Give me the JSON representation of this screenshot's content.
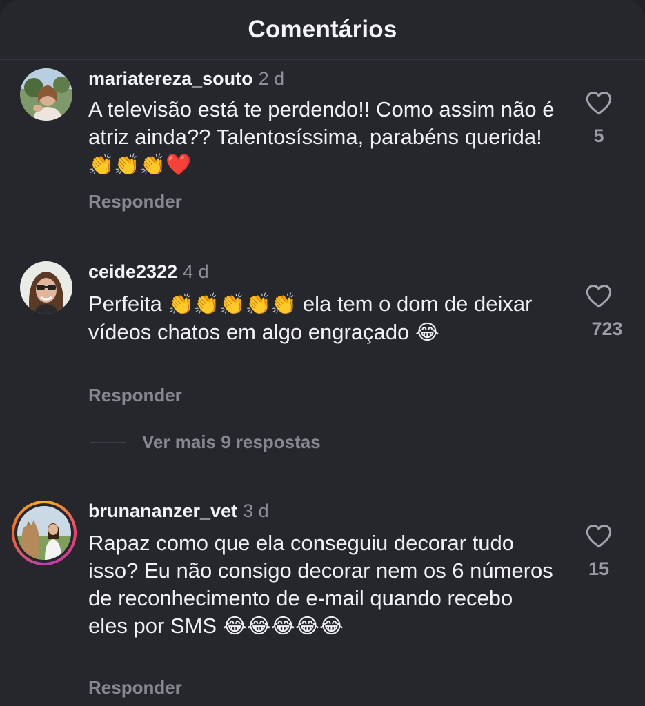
{
  "header": {
    "title": "Comentários"
  },
  "comments": [
    {
      "username": "mariatereza_souto",
      "time": "2 d",
      "text_parts": [
        "A televisão está te perdendo!! Como assim não é atriz ainda?? Talentosíssima, parabéns querida! ",
        "👏👏👏❤️"
      ],
      "reply_label": "Responder",
      "likes": "5"
    },
    {
      "username": "ceide2322",
      "time": "4 d",
      "text_parts": [
        "Perfeita ",
        "👏👏👏👏👏",
        " ela tem o dom de deixar vídeos chatos em algo engraçado ",
        "😂"
      ],
      "reply_label": "Responder",
      "likes": "723",
      "more_replies": "Ver mais 9 respostas"
    },
    {
      "username": "brunananzer_vet",
      "time": "3 d",
      "text_parts": [
        "Rapaz como que ela conseguiu decorar tudo isso? Eu não consigo decorar nem os 6 números de reconhecimento de e-mail quando recebo eles por SMS ",
        "😂😂😂😂😂"
      ],
      "reply_label": "Responder",
      "likes": "15"
    }
  ],
  "icons": {
    "like": "heart-outline-icon"
  },
  "colors": {
    "background": "#25272d",
    "muted": "#86888f",
    "text": "#f1f1f3",
    "story_ring": [
      "#f6b21c",
      "#ee3f6c",
      "#c23bb5"
    ]
  }
}
